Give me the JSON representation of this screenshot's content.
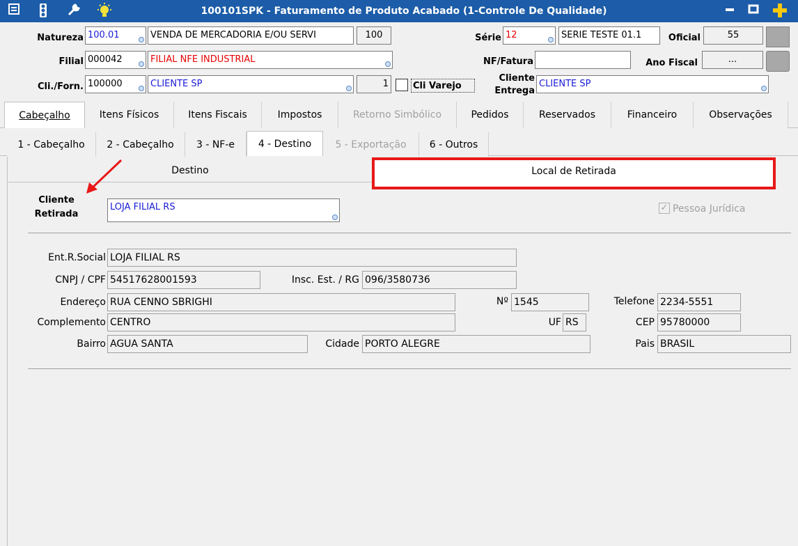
{
  "window": {
    "title": "100101SPK - Faturamento de Produto Acabado (1-Controle De Qualidade)"
  },
  "header": {
    "natureza": {
      "label": "Natureza",
      "code": "100.01",
      "desc": "VENDA DE MERCADORIA E/OU SERVI",
      "num": "100"
    },
    "serie": {
      "label": "Série",
      "code": "12",
      "desc": "SERIE TESTE 01.1",
      "oficial_label": "Oficial",
      "oficial_value": "55"
    },
    "filial": {
      "label": "Filial",
      "code": "000042",
      "desc": "FILIAL NFE INDUSTRIAL"
    },
    "nf": {
      "label": "NF/Fatura",
      "value": ""
    },
    "ano": {
      "label": "Ano Fiscal",
      "value": "..."
    },
    "cli": {
      "label": "Cli./Forn.",
      "code": "100000",
      "desc": "CLIENTE SP",
      "num": "1"
    },
    "cli_varejo": "Cli Varejo",
    "cliente_entrega": {
      "label1": "Cliente",
      "label2": "Entrega",
      "value": "CLIENTE SP"
    }
  },
  "tabs": [
    "Cabeçalho",
    "Itens Físicos",
    "Itens Fiscais",
    "Impostos",
    "Retorno Simbólico",
    "Pedidos",
    "Reservados",
    "Financeiro",
    "Observações"
  ],
  "subtabs": [
    "1 - Cabeçalho",
    "2 - Cabeçalho",
    "3 - NF-e",
    "4 - Destino",
    "5 - Exportação",
    "6 - Outros"
  ],
  "section_tabs": {
    "left": "Destino",
    "right": "Local de Retirada"
  },
  "retirada": {
    "label1": "Cliente",
    "label2": "Retirada",
    "value": "LOJA FILIAL RS",
    "pessoa_juridica": "Pessoa Jurídica"
  },
  "form": {
    "razao_label": "Ent.R.Social",
    "razao": "LOJA FILIAL RS",
    "cnpj_label": "CNPJ / CPF",
    "cnpj": "54517628001593",
    "insc_label": "Insc. Est. / RG",
    "insc": "096/3580736",
    "endereco_label": "Endereço",
    "endereco": "RUA CENNO SBRIGHI",
    "numero_label": "Nº",
    "numero": "1545",
    "telefone_label": "Telefone",
    "telefone": "2234-5551",
    "complemento_label": "Complemento",
    "complemento": "CENTRO",
    "uf_label": "UF",
    "uf": "RS",
    "cep_label": "CEP",
    "cep": "95780000",
    "bairro_label": "Bairro",
    "bairro": "AGUA SANTA",
    "cidade_label": "Cidade",
    "cidade": "PORTO ALEGRE",
    "pais_label": "Pais",
    "pais": "BRASIL"
  },
  "colors": {
    "titlebar": "#1c5ca8",
    "highlight": "#e81818",
    "blue_text": "#1a1ad6",
    "red_text": "#e60000"
  }
}
